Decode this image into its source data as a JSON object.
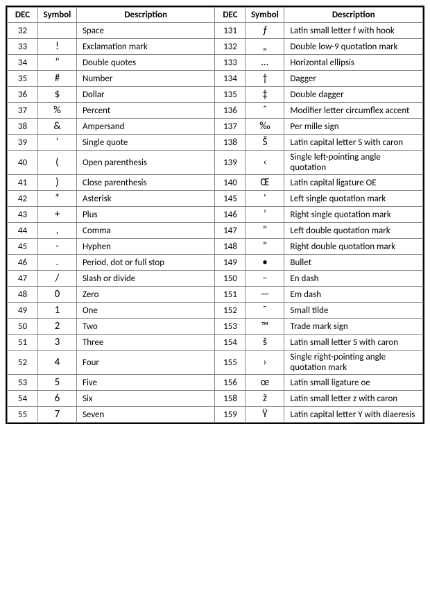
{
  "headers": {
    "dec": "DEC",
    "symbol": "Symbol",
    "description": "Description"
  },
  "left_rows": [
    {
      "dec": "32",
      "sym": " ",
      "desc": "Space"
    },
    {
      "dec": "33",
      "sym": "!",
      "desc": "Exclamation mark"
    },
    {
      "dec": "34",
      "sym": "\"",
      "desc": "Double quotes"
    },
    {
      "dec": "35",
      "sym": "#",
      "desc": "Number"
    },
    {
      "dec": "36",
      "sym": "$",
      "desc": "Dollar"
    },
    {
      "dec": "37",
      "sym": "%",
      "desc": "Percent"
    },
    {
      "dec": "38",
      "sym": "&",
      "desc": "Ampersand"
    },
    {
      "dec": "39",
      "sym": "'",
      "desc": "Single quote"
    },
    {
      "dec": "40",
      "sym": "(",
      "desc": "Open parenthesis"
    },
    {
      "dec": "41",
      "sym": ")",
      "desc": "Close parenthesis"
    },
    {
      "dec": "42",
      "sym": "*",
      "desc": "Asterisk"
    },
    {
      "dec": "43",
      "sym": "+",
      "desc": "Plus"
    },
    {
      "dec": "44",
      "sym": ",",
      "desc": "Comma"
    },
    {
      "dec": "45",
      "sym": "-",
      "desc": "Hyphen"
    },
    {
      "dec": "46",
      "sym": ".",
      "desc": "Period, dot or full stop"
    },
    {
      "dec": "47",
      "sym": "/",
      "desc": "Slash or divide"
    },
    {
      "dec": "48",
      "sym": "0",
      "desc": "Zero"
    },
    {
      "dec": "49",
      "sym": "1",
      "desc": "One"
    },
    {
      "dec": "50",
      "sym": "2",
      "desc": "Two"
    },
    {
      "dec": "51",
      "sym": "3",
      "desc": "Three"
    },
    {
      "dec": "52",
      "sym": "4",
      "desc": "Four"
    },
    {
      "dec": "53",
      "sym": "5",
      "desc": "Five"
    },
    {
      "dec": "54",
      "sym": "6",
      "desc": "Six"
    },
    {
      "dec": "55",
      "sym": "7",
      "desc": "Seven"
    }
  ],
  "right_rows": [
    {
      "dec": "131",
      "sym": "ƒ",
      "desc": "Latin small letter f with hook"
    },
    {
      "dec": "132",
      "sym": "„",
      "desc": "Double low-9 quotation mark"
    },
    {
      "dec": "133",
      "sym": "…",
      "desc": "Horizontal ellipsis"
    },
    {
      "dec": "134",
      "sym": "†",
      "desc": "Dagger"
    },
    {
      "dec": "135",
      "sym": "‡",
      "desc": "Double dagger"
    },
    {
      "dec": "136",
      "sym": "ˆ",
      "desc": "Modifier letter circumflex accent"
    },
    {
      "dec": "137",
      "sym": "‰",
      "desc": "Per mille sign"
    },
    {
      "dec": "138",
      "sym": "Š",
      "desc": "Latin capital letter S with caron"
    },
    {
      "dec": "139",
      "sym": "‹",
      "desc": "Single left-pointing angle quotation"
    },
    {
      "dec": "140",
      "sym": "Œ",
      "desc": "Latin capital ligature OE"
    },
    {
      "dec": "145",
      "sym": "‘",
      "desc": "Left single quotation mark"
    },
    {
      "dec": "146",
      "sym": "’",
      "desc": "Right single quotation mark"
    },
    {
      "dec": "147",
      "sym": "“",
      "desc": "Left double quotation mark"
    },
    {
      "dec": "148",
      "sym": "”",
      "desc": "Right double quotation mark"
    },
    {
      "dec": "149",
      "sym": "•",
      "desc": "Bullet"
    },
    {
      "dec": "150",
      "sym": "–",
      "desc": "En dash"
    },
    {
      "dec": "151",
      "sym": "—",
      "desc": "Em dash"
    },
    {
      "dec": "152",
      "sym": "˜",
      "desc": "Small tilde"
    },
    {
      "dec": "153",
      "sym": "™",
      "desc": "Trade mark sign"
    },
    {
      "dec": "154",
      "sym": "š",
      "desc": "Latin small letter S with caron"
    },
    {
      "dec": "155",
      "sym": "›",
      "desc": "Single right-pointing angle quotation mark"
    },
    {
      "dec": "156",
      "sym": "œ",
      "desc": "Latin small ligature oe"
    },
    {
      "dec": "158",
      "sym": "ž",
      "desc": "Latin small letter z with caron"
    },
    {
      "dec": "159",
      "sym": "Ÿ",
      "desc": "Latin capital letter Y with diaeresis"
    }
  ]
}
